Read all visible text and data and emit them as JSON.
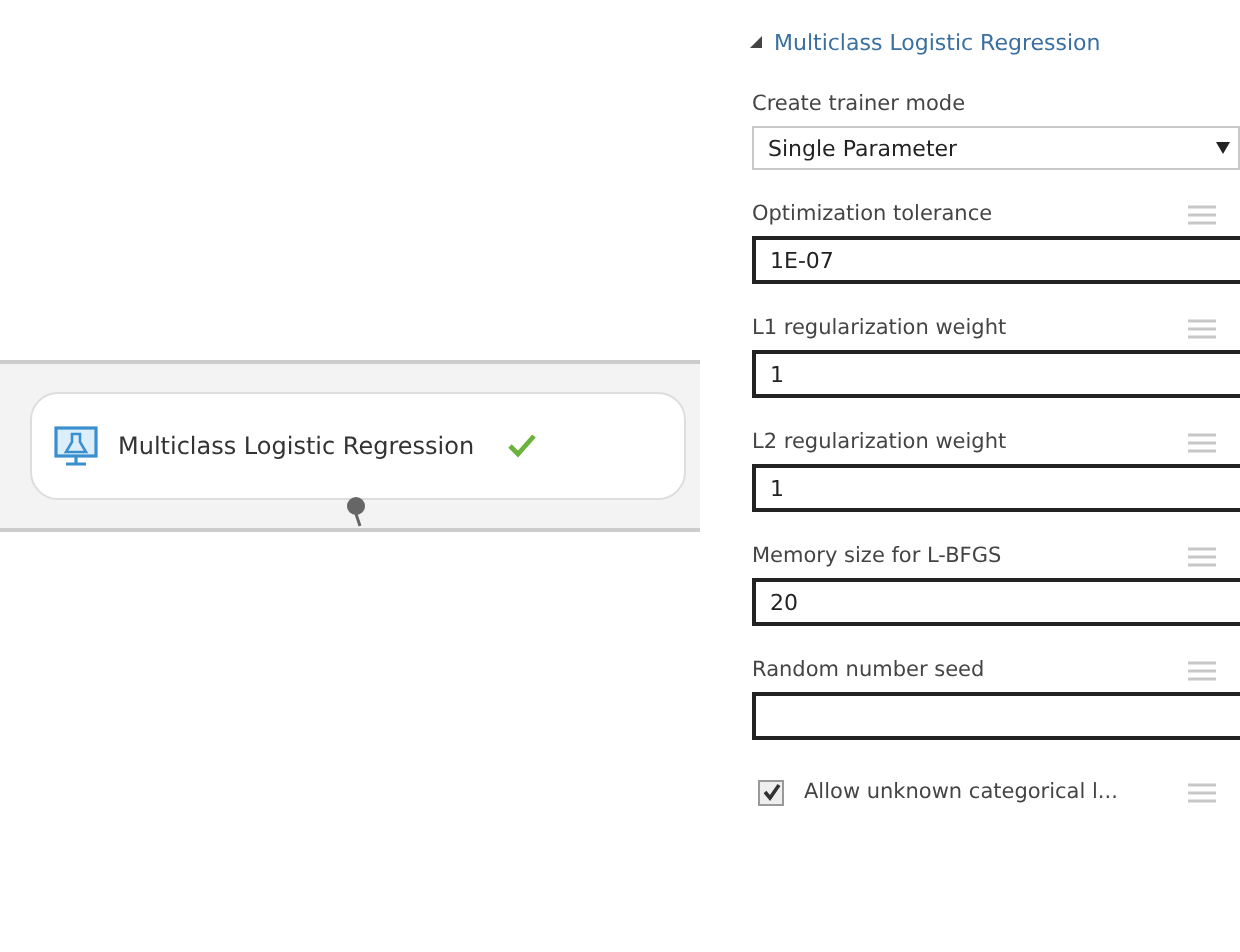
{
  "module": {
    "name": "Multiclass Logistic Regression"
  },
  "panel": {
    "title": "Multiclass Logistic Regression",
    "expanded": true,
    "params": [
      {
        "kind": "select",
        "label": "Create trainer mode",
        "value": "Single Parameter"
      },
      {
        "kind": "input",
        "label": "Optimization tolerance",
        "value": "1E-07"
      },
      {
        "kind": "input",
        "label": "L1 regularization weight",
        "value": "1"
      },
      {
        "kind": "input",
        "label": "L2 regularization weight",
        "value": "1"
      },
      {
        "kind": "input",
        "label": "Memory size for L-BFGS",
        "value": "20"
      },
      {
        "kind": "input",
        "label": "Random number seed"
      },
      {
        "kind": "checkbox",
        "label": "Allow unknown categorical l...",
        "checked": true
      }
    ]
  }
}
